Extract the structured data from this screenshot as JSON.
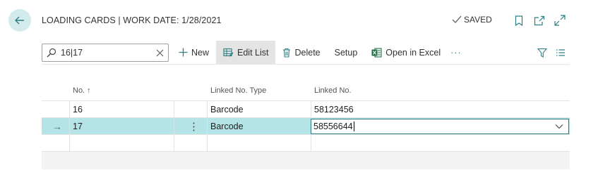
{
  "header": {
    "title": "LOADING CARDS | WORK DATE: 1/28/2021",
    "saved_label": "SAVED"
  },
  "toolbar": {
    "search_value": "16|17",
    "new_label": "New",
    "edit_list_label": "Edit List",
    "delete_label": "Delete",
    "setup_label": "Setup",
    "open_excel_label": "Open in Excel",
    "more_label": "···"
  },
  "grid": {
    "columns": [
      "No. ↑",
      "Linked No. Type",
      "Linked No."
    ],
    "rows": [
      {
        "no": "16",
        "linked_type": "Barcode",
        "linked_no": "58123456"
      },
      {
        "no": "17",
        "linked_type": "Barcode",
        "linked_no": "58556644"
      }
    ],
    "row_menu_glyph": "⋮",
    "selected_row_arrow": "→"
  },
  "colors": {
    "accent": "#2d7f83",
    "selected_row": "#b4e4e6",
    "back_button_bg": "#d3ebec"
  },
  "icons": [
    "back-arrow-icon",
    "check-icon",
    "bookmark-icon",
    "open-new-window-icon",
    "expand-icon",
    "search-icon",
    "clear-icon",
    "plus-icon",
    "edit-list-icon",
    "trash-icon",
    "excel-icon",
    "filter-icon",
    "list-view-icon",
    "chevron-down-icon"
  ]
}
